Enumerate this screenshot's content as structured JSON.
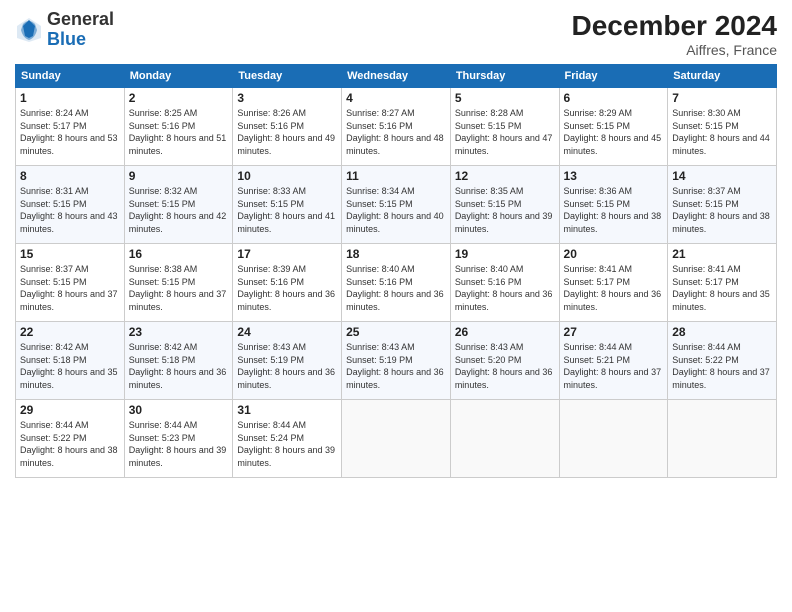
{
  "logo": {
    "general": "General",
    "blue": "Blue"
  },
  "header": {
    "month": "December 2024",
    "location": "Aiffres, France"
  },
  "weekdays": [
    "Sunday",
    "Monday",
    "Tuesday",
    "Wednesday",
    "Thursday",
    "Friday",
    "Saturday"
  ],
  "weeks": [
    [
      {
        "day": "1",
        "sunrise": "Sunrise: 8:24 AM",
        "sunset": "Sunset: 5:17 PM",
        "daylight": "Daylight: 8 hours and 53 minutes."
      },
      {
        "day": "2",
        "sunrise": "Sunrise: 8:25 AM",
        "sunset": "Sunset: 5:16 PM",
        "daylight": "Daylight: 8 hours and 51 minutes."
      },
      {
        "day": "3",
        "sunrise": "Sunrise: 8:26 AM",
        "sunset": "Sunset: 5:16 PM",
        "daylight": "Daylight: 8 hours and 49 minutes."
      },
      {
        "day": "4",
        "sunrise": "Sunrise: 8:27 AM",
        "sunset": "Sunset: 5:16 PM",
        "daylight": "Daylight: 8 hours and 48 minutes."
      },
      {
        "day": "5",
        "sunrise": "Sunrise: 8:28 AM",
        "sunset": "Sunset: 5:15 PM",
        "daylight": "Daylight: 8 hours and 47 minutes."
      },
      {
        "day": "6",
        "sunrise": "Sunrise: 8:29 AM",
        "sunset": "Sunset: 5:15 PM",
        "daylight": "Daylight: 8 hours and 45 minutes."
      },
      {
        "day": "7",
        "sunrise": "Sunrise: 8:30 AM",
        "sunset": "Sunset: 5:15 PM",
        "daylight": "Daylight: 8 hours and 44 minutes."
      }
    ],
    [
      {
        "day": "8",
        "sunrise": "Sunrise: 8:31 AM",
        "sunset": "Sunset: 5:15 PM",
        "daylight": "Daylight: 8 hours and 43 minutes."
      },
      {
        "day": "9",
        "sunrise": "Sunrise: 8:32 AM",
        "sunset": "Sunset: 5:15 PM",
        "daylight": "Daylight: 8 hours and 42 minutes."
      },
      {
        "day": "10",
        "sunrise": "Sunrise: 8:33 AM",
        "sunset": "Sunset: 5:15 PM",
        "daylight": "Daylight: 8 hours and 41 minutes."
      },
      {
        "day": "11",
        "sunrise": "Sunrise: 8:34 AM",
        "sunset": "Sunset: 5:15 PM",
        "daylight": "Daylight: 8 hours and 40 minutes."
      },
      {
        "day": "12",
        "sunrise": "Sunrise: 8:35 AM",
        "sunset": "Sunset: 5:15 PM",
        "daylight": "Daylight: 8 hours and 39 minutes."
      },
      {
        "day": "13",
        "sunrise": "Sunrise: 8:36 AM",
        "sunset": "Sunset: 5:15 PM",
        "daylight": "Daylight: 8 hours and 38 minutes."
      },
      {
        "day": "14",
        "sunrise": "Sunrise: 8:37 AM",
        "sunset": "Sunset: 5:15 PM",
        "daylight": "Daylight: 8 hours and 38 minutes."
      }
    ],
    [
      {
        "day": "15",
        "sunrise": "Sunrise: 8:37 AM",
        "sunset": "Sunset: 5:15 PM",
        "daylight": "Daylight: 8 hours and 37 minutes."
      },
      {
        "day": "16",
        "sunrise": "Sunrise: 8:38 AM",
        "sunset": "Sunset: 5:15 PM",
        "daylight": "Daylight: 8 hours and 37 minutes."
      },
      {
        "day": "17",
        "sunrise": "Sunrise: 8:39 AM",
        "sunset": "Sunset: 5:16 PM",
        "daylight": "Daylight: 8 hours and 36 minutes."
      },
      {
        "day": "18",
        "sunrise": "Sunrise: 8:40 AM",
        "sunset": "Sunset: 5:16 PM",
        "daylight": "Daylight: 8 hours and 36 minutes."
      },
      {
        "day": "19",
        "sunrise": "Sunrise: 8:40 AM",
        "sunset": "Sunset: 5:16 PM",
        "daylight": "Daylight: 8 hours and 36 minutes."
      },
      {
        "day": "20",
        "sunrise": "Sunrise: 8:41 AM",
        "sunset": "Sunset: 5:17 PM",
        "daylight": "Daylight: 8 hours and 36 minutes."
      },
      {
        "day": "21",
        "sunrise": "Sunrise: 8:41 AM",
        "sunset": "Sunset: 5:17 PM",
        "daylight": "Daylight: 8 hours and 35 minutes."
      }
    ],
    [
      {
        "day": "22",
        "sunrise": "Sunrise: 8:42 AM",
        "sunset": "Sunset: 5:18 PM",
        "daylight": "Daylight: 8 hours and 35 minutes."
      },
      {
        "day": "23",
        "sunrise": "Sunrise: 8:42 AM",
        "sunset": "Sunset: 5:18 PM",
        "daylight": "Daylight: 8 hours and 36 minutes."
      },
      {
        "day": "24",
        "sunrise": "Sunrise: 8:43 AM",
        "sunset": "Sunset: 5:19 PM",
        "daylight": "Daylight: 8 hours and 36 minutes."
      },
      {
        "day": "25",
        "sunrise": "Sunrise: 8:43 AM",
        "sunset": "Sunset: 5:19 PM",
        "daylight": "Daylight: 8 hours and 36 minutes."
      },
      {
        "day": "26",
        "sunrise": "Sunrise: 8:43 AM",
        "sunset": "Sunset: 5:20 PM",
        "daylight": "Daylight: 8 hours and 36 minutes."
      },
      {
        "day": "27",
        "sunrise": "Sunrise: 8:44 AM",
        "sunset": "Sunset: 5:21 PM",
        "daylight": "Daylight: 8 hours and 37 minutes."
      },
      {
        "day": "28",
        "sunrise": "Sunrise: 8:44 AM",
        "sunset": "Sunset: 5:22 PM",
        "daylight": "Daylight: 8 hours and 37 minutes."
      }
    ],
    [
      {
        "day": "29",
        "sunrise": "Sunrise: 8:44 AM",
        "sunset": "Sunset: 5:22 PM",
        "daylight": "Daylight: 8 hours and 38 minutes."
      },
      {
        "day": "30",
        "sunrise": "Sunrise: 8:44 AM",
        "sunset": "Sunset: 5:23 PM",
        "daylight": "Daylight: 8 hours and 39 minutes."
      },
      {
        "day": "31",
        "sunrise": "Sunrise: 8:44 AM",
        "sunset": "Sunset: 5:24 PM",
        "daylight": "Daylight: 8 hours and 39 minutes."
      },
      null,
      null,
      null,
      null
    ]
  ]
}
